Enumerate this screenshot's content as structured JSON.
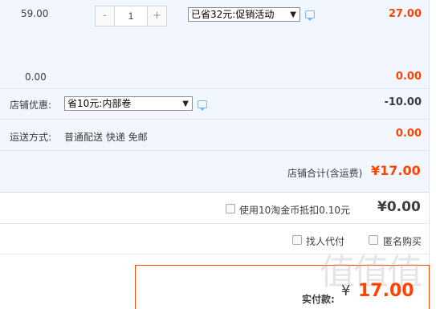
{
  "item": {
    "unit_price": "59.00",
    "quantity": "1",
    "minus_label": "-",
    "plus_label": "+",
    "promo_select": "已省32元:促销活动",
    "subtotal": "27.00",
    "zero_price": "0.00",
    "zero_amount": "0.00"
  },
  "shop": {
    "discount_label": "店铺优惠:",
    "discount_select": "省10元:内部卷",
    "discount_value": "-10.00",
    "shipping_label": "运送方式:",
    "shipping_method": "普通配送 快递 免邮",
    "shipping_value": "0.00",
    "total_label": "店铺合计(含运费)",
    "total_value": "¥17.00"
  },
  "coins": {
    "label": "使用10淘金币抵扣0.10元",
    "value": "¥0.00"
  },
  "options": {
    "proxy_label": "找人代付",
    "anonymous_label": "匿名购买"
  },
  "payment": {
    "label": "实付款:",
    "currency": "¥",
    "value": "17.00"
  },
  "watermark": "值值值",
  "colors": {
    "accent": "#ff4400",
    "panel_bg": "#f2f7ff",
    "link_blue": "#7fb6e8"
  },
  "icons": {
    "chat": "chat-bubble-icon",
    "dropdown": "chevron-down-icon"
  }
}
